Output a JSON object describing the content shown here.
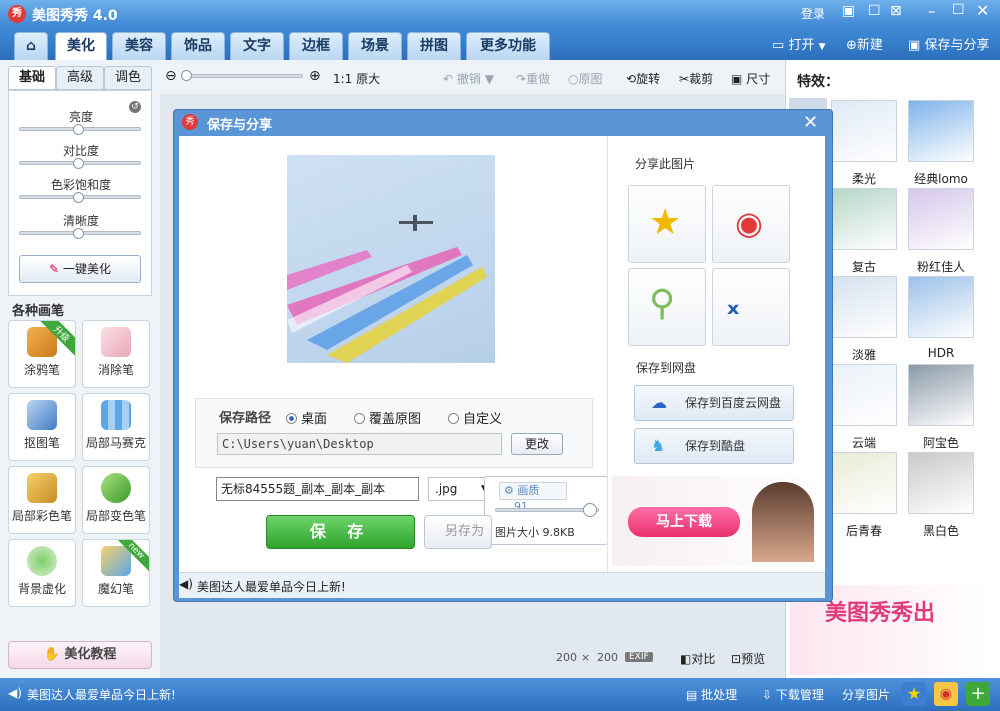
{
  "app": {
    "title": "美图秀秀 4.0",
    "logo_text": "秀"
  },
  "titlebar": {
    "login": "登录"
  },
  "tabs": [
    "美化",
    "美容",
    "饰品",
    "文字",
    "边框",
    "场景",
    "拼图",
    "更多功能"
  ],
  "file_actions": {
    "open": "打开",
    "new": "新建",
    "save_share": "保存与分享"
  },
  "subtabs": [
    "基础",
    "高级",
    "调色"
  ],
  "adjust": {
    "brightness": "亮度",
    "contrast": "对比度",
    "saturation": "色彩饱和度",
    "sharpness": "清晰度",
    "one_key": "一键美化"
  },
  "brushes": {
    "title": "各种画笔",
    "items": [
      {
        "label": "涂鸦笔",
        "badge": "升级"
      },
      {
        "label": "消除笔",
        "badge": ""
      },
      {
        "label": "抠图笔",
        "badge": ""
      },
      {
        "label": "局部马赛克",
        "badge": ""
      },
      {
        "label": "局部彩色笔",
        "badge": ""
      },
      {
        "label": "局部变色笔",
        "badge": ""
      },
      {
        "label": "背景虚化",
        "badge": ""
      },
      {
        "label": "魔幻笔",
        "badge": "new"
      }
    ]
  },
  "tutorial": "美化教程",
  "toolbar": {
    "zoom_original": "1:1 原大",
    "undo": "撤销",
    "redo": "重做",
    "original": "原图",
    "rotate": "旋转",
    "crop": "裁剪",
    "size": "尺寸"
  },
  "effects": {
    "title": "特效：",
    "items": [
      {
        "label": "柔光",
        "color": "#dfe9f5"
      },
      {
        "label": "经典lomo",
        "color": "#7fb3ea"
      },
      {
        "label": "复古",
        "color": "#b6d6c9"
      },
      {
        "label": "粉红佳人",
        "color": "#d5c6ea"
      },
      {
        "label": "淡雅",
        "color": "#d6e2ef"
      },
      {
        "label": "HDR",
        "color": "#9cc1ea"
      },
      {
        "label": "云端",
        "color": "#eaf1f8"
      },
      {
        "label": "阿宝色",
        "color": "#8b9aa8"
      },
      {
        "label": "后青春",
        "color": "#e8ecd7"
      },
      {
        "label": "黑白色",
        "color": "#c9c9c9"
      }
    ]
  },
  "promo": {
    "text": "美图秀秀出"
  },
  "canvas_info": {
    "width": "200",
    "times": "×",
    "height": "200",
    "exif": "EXIF",
    "compare": "对比",
    "preview": "预览"
  },
  "status": {
    "news": "美图达人最爱单品今日上新!",
    "batch": "批处理",
    "download": "下载管理",
    "share": "分享图片"
  },
  "dialog": {
    "title": "保存与分享",
    "save_path_label": "保存路径",
    "radio_desktop": "桌面",
    "radio_overwrite": "覆盖原图",
    "radio_custom": "自定义",
    "path": "C:\\Users\\yuan\\Desktop",
    "change": "更改",
    "filename": "无标84555题_副本_副本_副本",
    "format": ".jpg",
    "quality_label": "画质",
    "quality_value": "91",
    "quality_level": 0.91,
    "filesize": "图片大小  9.8KB",
    "save": "保 存",
    "save_as": "另存为",
    "share_title": "分享此图片",
    "cloud_title": "保存到网盘",
    "cloud_baidu": "保存到百度云网盘",
    "cloud_kupan": "保存到酷盘",
    "ad_button": "马上下载",
    "footer_news": "美图达人最爱单品今日上新!"
  }
}
